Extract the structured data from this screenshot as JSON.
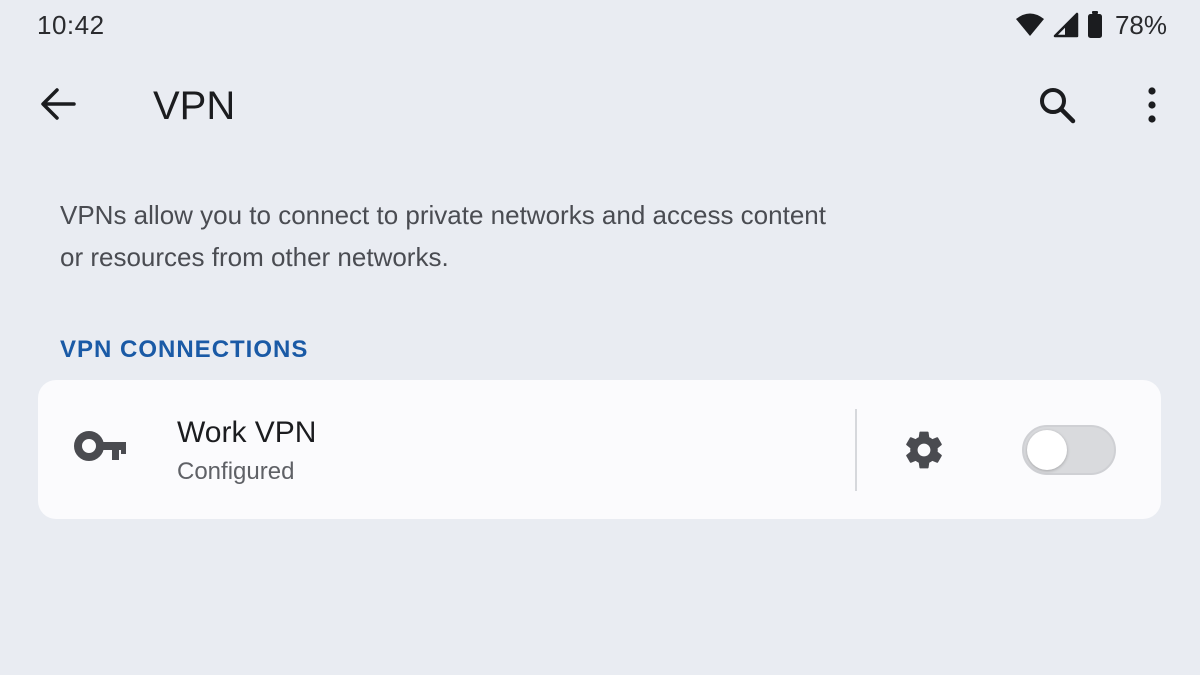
{
  "status_bar": {
    "time": "10:42",
    "battery_percent": "78%",
    "icons": [
      "wifi-icon",
      "cell-signal-icon",
      "battery-icon"
    ]
  },
  "app_bar": {
    "title": "VPN",
    "icons": [
      "back-arrow-icon",
      "search-icon",
      "more-vertical-icon"
    ]
  },
  "description": {
    "line1": "VPNs allow you to connect to private networks and access content",
    "line2": "or resources from other networks."
  },
  "section": {
    "header": "VPN CONNECTIONS"
  },
  "vpn_connections": [
    {
      "name": "Work VPN",
      "status": "Configured",
      "icon": "key-icon",
      "settings_icon": "gear-icon",
      "enabled": false
    }
  ],
  "colors": {
    "background": "#e9ecf2",
    "card": "#fbfbfd",
    "accent": "#1a5aa6",
    "text_primary": "#1b1c1f",
    "text_secondary": "#5f6166",
    "icon": "#4a4b50",
    "toggle_off_track": "#d9dadd"
  }
}
